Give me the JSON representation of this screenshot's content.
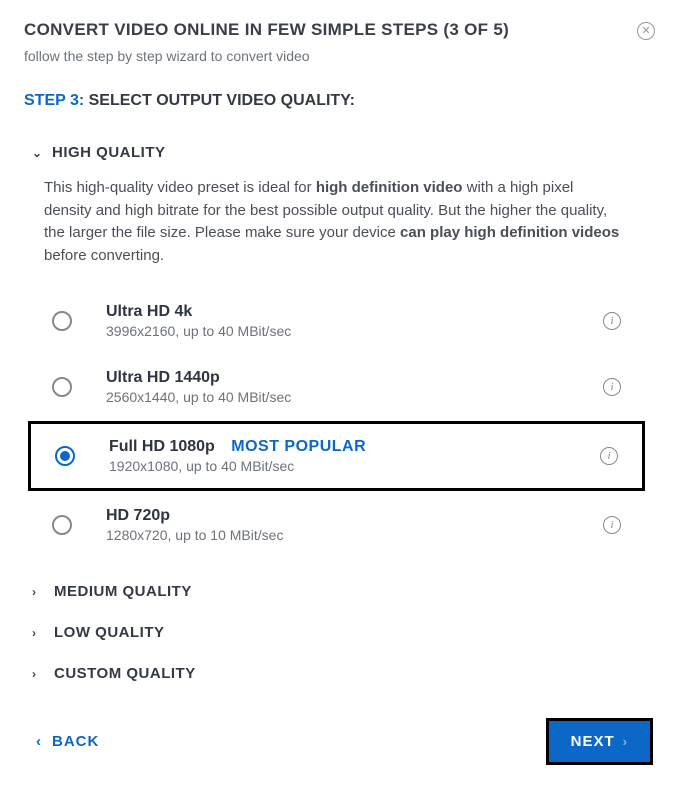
{
  "header": {
    "title": "CONVERT VIDEO ONLINE IN FEW SIMPLE STEPS (3 OF 5)",
    "subtitle": "follow the step by step wizard to convert video"
  },
  "step": {
    "label": "STEP 3:",
    "text": "SELECT OUTPUT VIDEO QUALITY:"
  },
  "sections": {
    "high": {
      "title": "HIGH QUALITY",
      "desc_pre": "This high-quality video preset is ideal for ",
      "desc_b1": "high definition video",
      "desc_mid": " with a high pixel density and high bitrate for the best possible output quality. But the higher the quality, the larger the file size. Please make sure your device ",
      "desc_b2": "can play high definition videos",
      "desc_post": " before converting.",
      "options": [
        {
          "title": "Ultra HD 4k",
          "sub": "3996x2160, up to 40 MBit/sec",
          "badge": "",
          "selected": false
        },
        {
          "title": "Ultra HD 1440p",
          "sub": "2560x1440, up to 40 MBit/sec",
          "badge": "",
          "selected": false
        },
        {
          "title": "Full HD 1080p",
          "sub": "1920x1080, up to 40 MBit/sec",
          "badge": "MOST POPULAR",
          "selected": true
        },
        {
          "title": "HD 720p",
          "sub": "1280x720, up to 10 MBit/sec",
          "badge": "",
          "selected": false
        }
      ]
    },
    "medium": {
      "title": "MEDIUM QUALITY"
    },
    "low": {
      "title": "LOW QUALITY"
    },
    "custom": {
      "title": "CUSTOM QUALITY"
    }
  },
  "footer": {
    "back": "BACK",
    "next": "NEXT"
  }
}
